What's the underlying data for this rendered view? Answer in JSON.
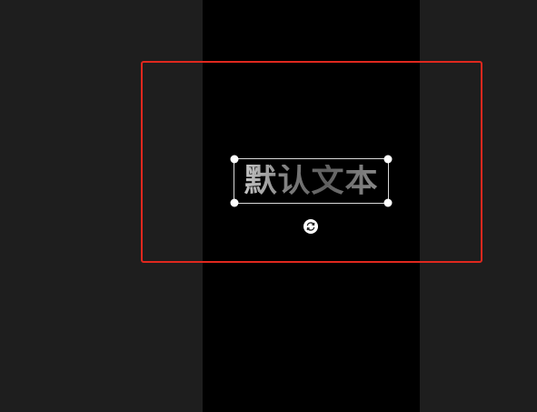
{
  "canvas": {
    "text_layer": {
      "text": "默认文本"
    },
    "icons": {
      "rotate": "rotate-icon",
      "handle": "resize-handle"
    },
    "colors": {
      "workspace_bg": "#1e1e1e",
      "canvas_bg": "#000000",
      "highlight_border": "#e0281e",
      "selection_border": "#d8d8d8"
    }
  }
}
